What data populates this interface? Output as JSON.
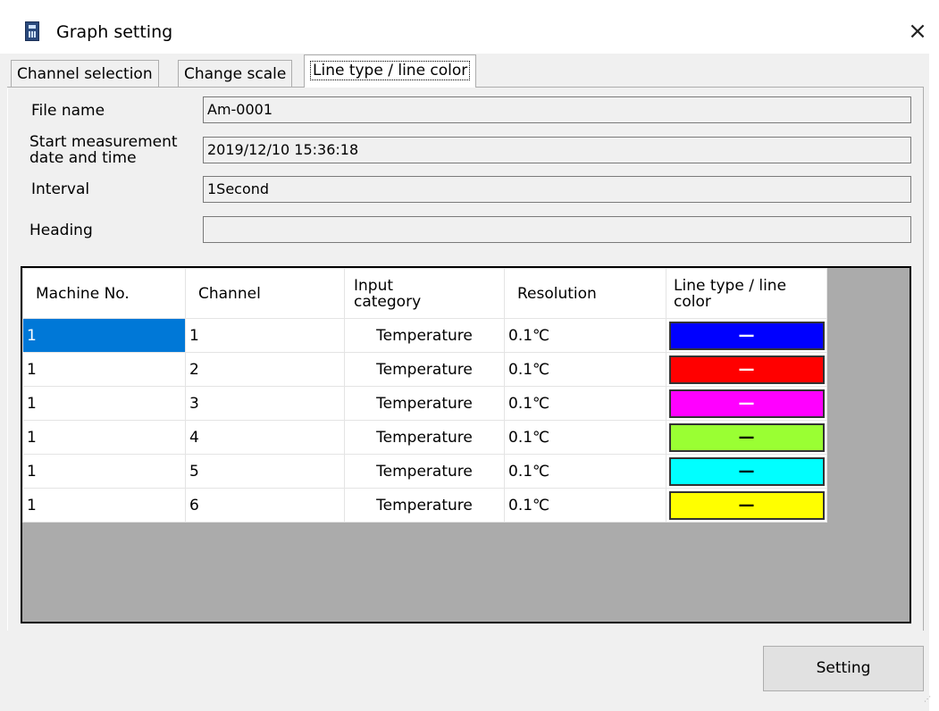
{
  "window": {
    "title": "Graph setting",
    "close_symbol": "×"
  },
  "tabs": [
    {
      "label": "Channel selection"
    },
    {
      "label": "Change scale"
    },
    {
      "label": "Line type / line color"
    }
  ],
  "fields": {
    "file_name": {
      "label": "File name",
      "value": "Am-0001"
    },
    "start": {
      "label_line1": "Start measurement",
      "label_line2": "date and time",
      "value": "2019/12/10 15:36:18"
    },
    "interval": {
      "label": "Interval",
      "value": "1Second"
    },
    "heading": {
      "label": "Heading",
      "value": ""
    }
  },
  "table": {
    "headers": {
      "machine": "Machine No.",
      "channel": "Channel",
      "input_line1": "Input",
      "input_line2": "category",
      "resolution": "Resolution",
      "line_line1": "Line type / line",
      "line_line2": "color"
    },
    "rows": [
      {
        "machine": "1",
        "channel": "1",
        "input": "Temperature",
        "resolution": "0.1℃",
        "line": "—",
        "color": "#0000ff"
      },
      {
        "machine": "1",
        "channel": "2",
        "input": "Temperature",
        "resolution": "0.1℃",
        "line": "—",
        "color": "#ff0000"
      },
      {
        "machine": "1",
        "channel": "3",
        "input": "Temperature",
        "resolution": "0.1℃",
        "line": "—",
        "color": "#ff00ff"
      },
      {
        "machine": "1",
        "channel": "4",
        "input": "Temperature",
        "resolution": "0.1℃",
        "line": "—",
        "color": "#9aff33"
      },
      {
        "machine": "1",
        "channel": "5",
        "input": "Temperature",
        "resolution": "0.1℃",
        "line": "—",
        "color": "#00ffff"
      },
      {
        "machine": "1",
        "channel": "6",
        "input": "Temperature",
        "resolution": "0.1℃",
        "line": "—",
        "color": "#ffff00"
      }
    ]
  },
  "buttons": {
    "setting": "Setting"
  },
  "colors": {
    "selection": "#0078d7",
    "grid_background": "#ababab",
    "window_background": "#f0f0f0"
  }
}
